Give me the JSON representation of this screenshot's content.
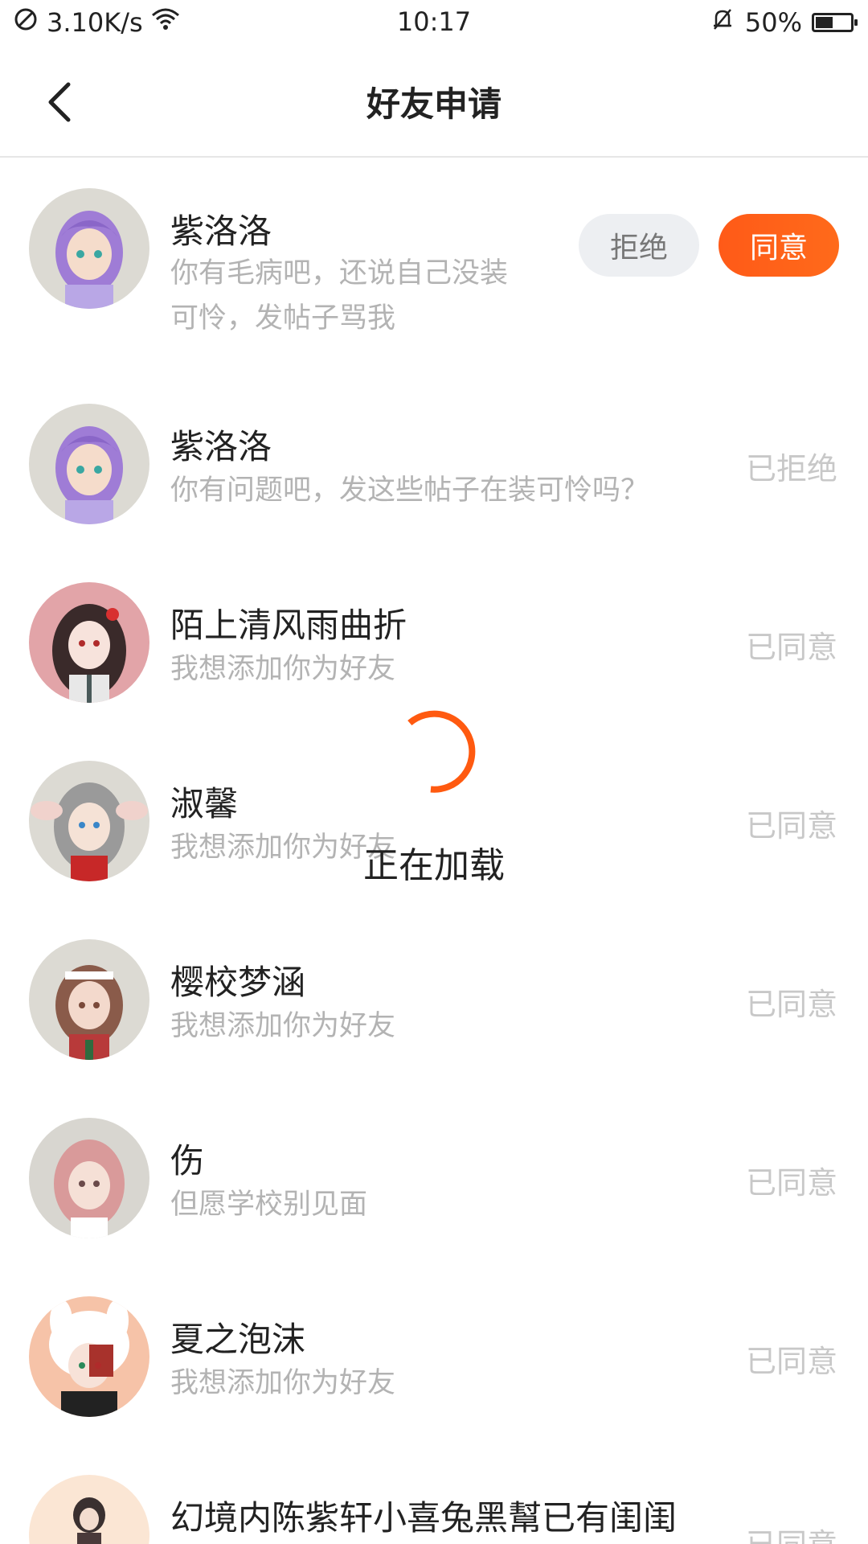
{
  "status_bar": {
    "network_speed": "3.10K/s",
    "time": "10:17",
    "battery_percent": "50%",
    "battery_level": 0.5,
    "icons": [
      "no-sim-icon",
      "wifi-icon",
      "mute-bell-icon",
      "battery-icon"
    ]
  },
  "header": {
    "title": "好友申请",
    "back_icon": "chevron-left-icon"
  },
  "requests": [
    {
      "name": "紫洛洛",
      "message": "你有毛病吧，还说自己没装可怜，发帖子骂我",
      "message_lines": [
        "你有毛病吧，还说自己没装",
        "可怜，发帖子骂我"
      ],
      "status": "pending",
      "reject_label": "拒绝",
      "agree_label": "同意"
    },
    {
      "name": "紫洛洛",
      "message": "你有问题吧，发这些帖子在装可怜吗？",
      "status": "已拒绝"
    },
    {
      "name": "陌上清风雨曲折",
      "message": "我想添加你为好友",
      "status": "已同意"
    },
    {
      "name": "淑馨",
      "message": "我想添加你为好友",
      "status": "已同意"
    },
    {
      "name": "樱校梦涵",
      "message": "我想添加你为好友",
      "status": "已同意"
    },
    {
      "name": "伤",
      "message": "但愿学校别见面",
      "status": "已同意"
    },
    {
      "name": "夏之泡沫",
      "message": "我想添加你为好友",
      "status": "已同意"
    },
    {
      "name": "幻境内陈紫轩小喜兔黑幫已有闺闺",
      "message": "",
      "status": "已同意"
    }
  ],
  "loading": {
    "text": "正在加载",
    "accent_color": "#ff5a10"
  },
  "colors": {
    "accent": "#ff5a18",
    "muted_text": "#b3b3b3",
    "status_text": "#c8c8c8"
  }
}
